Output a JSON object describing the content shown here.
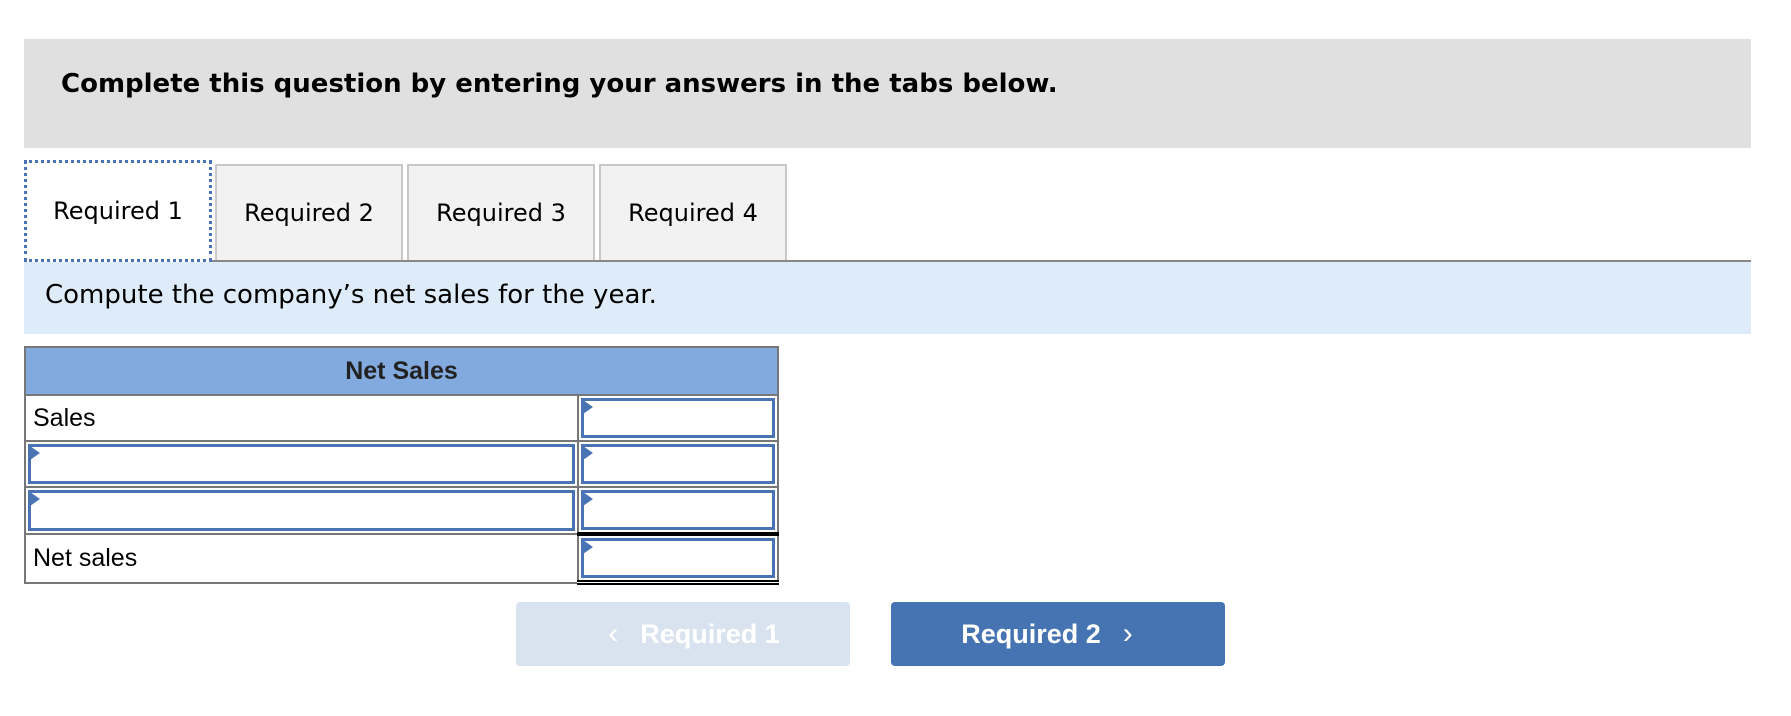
{
  "instructions": "Complete this question by entering your answers in the tabs below.",
  "tabs": [
    {
      "label": "Required 1",
      "active": true
    },
    {
      "label": "Required 2",
      "active": false
    },
    {
      "label": "Required 3",
      "active": false
    },
    {
      "label": "Required 4",
      "active": false
    }
  ],
  "prompt": "Compute the company’s net sales for the year.",
  "table": {
    "title": "Net Sales",
    "rows": [
      {
        "label": "Sales",
        "label_editable": false,
        "value": ""
      },
      {
        "label": "",
        "label_editable": true,
        "value": ""
      },
      {
        "label": "",
        "label_editable": true,
        "value": ""
      },
      {
        "label": "Net sales",
        "label_editable": false,
        "value": ""
      }
    ]
  },
  "nav": {
    "prev_label": "Required 1",
    "prev_icon": "chevron-left-icon",
    "next_label": "Required 2",
    "next_icon": "chevron-right-icon",
    "prev_chevron": "‹",
    "next_chevron": "›"
  },
  "colors": {
    "accent": "#4674b3",
    "header_bg": "#82aadf",
    "prompt_bg": "#deebf8"
  }
}
